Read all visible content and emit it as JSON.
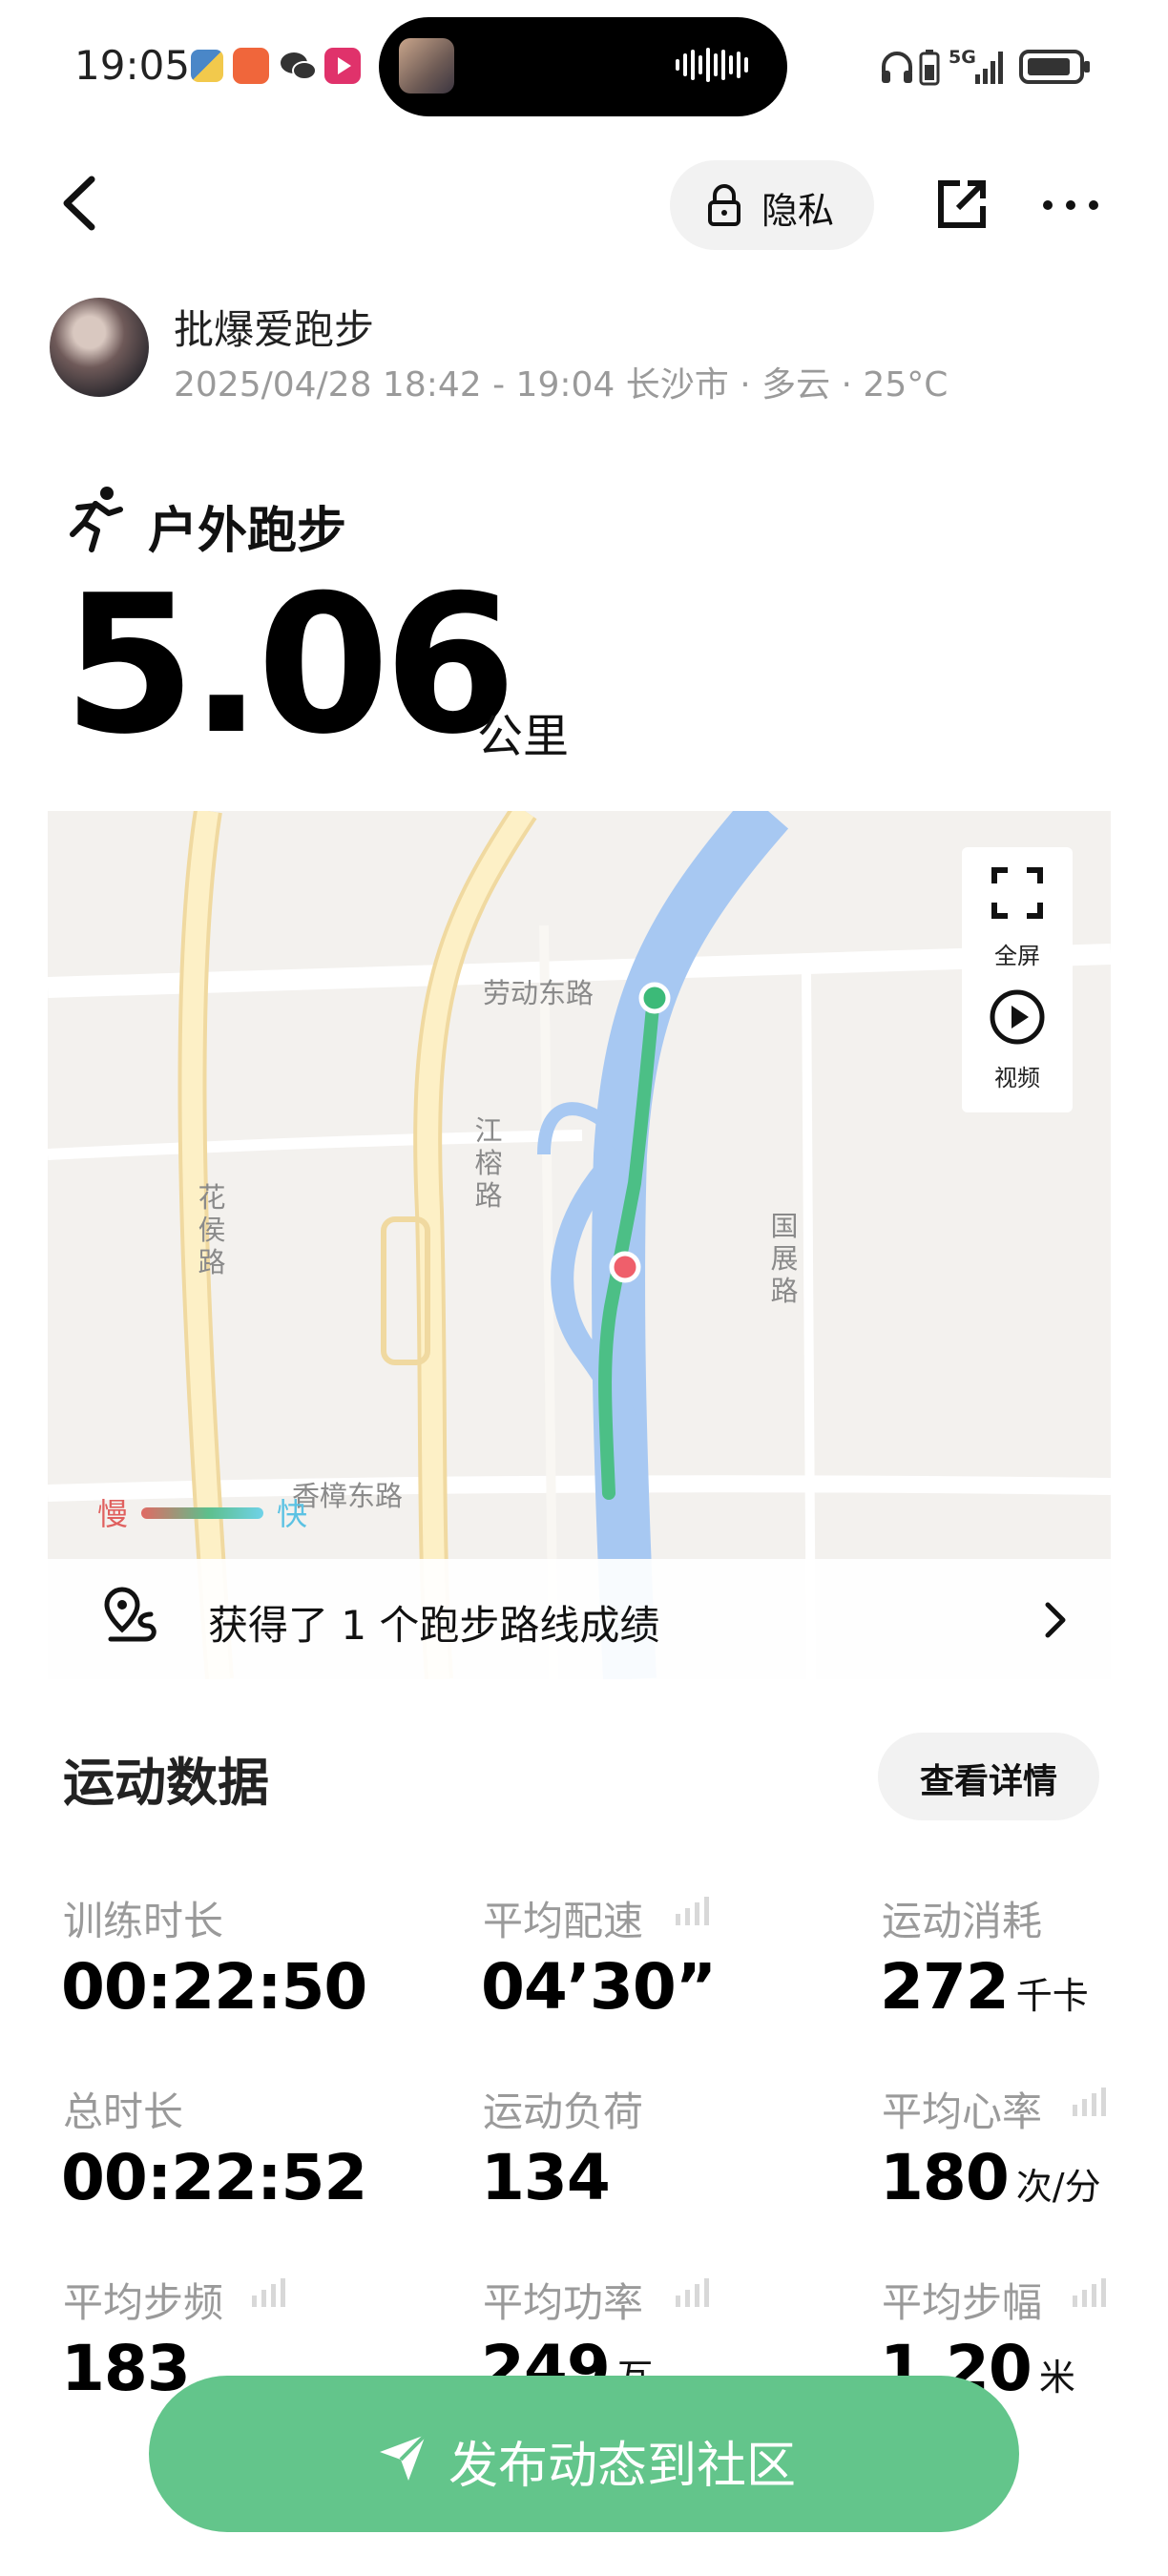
{
  "status_bar": {
    "time": "19:05"
  },
  "nav": {
    "privacy_label": "隐私"
  },
  "user": {
    "name": "批爆爱跑步",
    "meta": "2025/04/28 18:42 - 19:04 长沙市 · 多云 · 25°C"
  },
  "activity": {
    "type": "户外跑步",
    "distance": "5.06",
    "unit": "公里"
  },
  "map": {
    "roads": {
      "laodong": "劳动东路",
      "jiangrong": "江榕路",
      "huahou": "花侯路",
      "guozhan": "国展路",
      "xiangzhang": "香樟东路"
    },
    "controls": {
      "fullscreen": "全屏",
      "video": "视频"
    },
    "legend": {
      "slow": "慢",
      "fast": "快"
    },
    "colors": {
      "route": "#4cbf86",
      "start": "#3cba78",
      "end": "#ef5f6b",
      "river": "#a7c8f2"
    },
    "achievement": "获得了 1 个跑步路线成绩"
  },
  "stats": {
    "title": "运动数据",
    "detail_label": "查看详情",
    "items": [
      {
        "label": "训练时长",
        "value": "00:22:50",
        "unit": ""
      },
      {
        "label": "平均配速",
        "value": "04’30”",
        "unit": ""
      },
      {
        "label": "运动消耗",
        "value": "272",
        "unit": "千卡"
      },
      {
        "label": "总时长",
        "value": "00:22:52",
        "unit": ""
      },
      {
        "label": "运动负荷",
        "value": "134",
        "unit": ""
      },
      {
        "label": "平均心率",
        "value": "180",
        "unit": "次/分"
      },
      {
        "label": "平均步频",
        "value": "183",
        "unit": ""
      },
      {
        "label": "平均功率",
        "value": "249",
        "unit": "瓦"
      },
      {
        "label": "平均步幅",
        "value": "1.20",
        "unit": "米"
      }
    ]
  },
  "cta": {
    "label": "发布动态到社区"
  },
  "theme": {
    "accent": "#63c58b"
  }
}
